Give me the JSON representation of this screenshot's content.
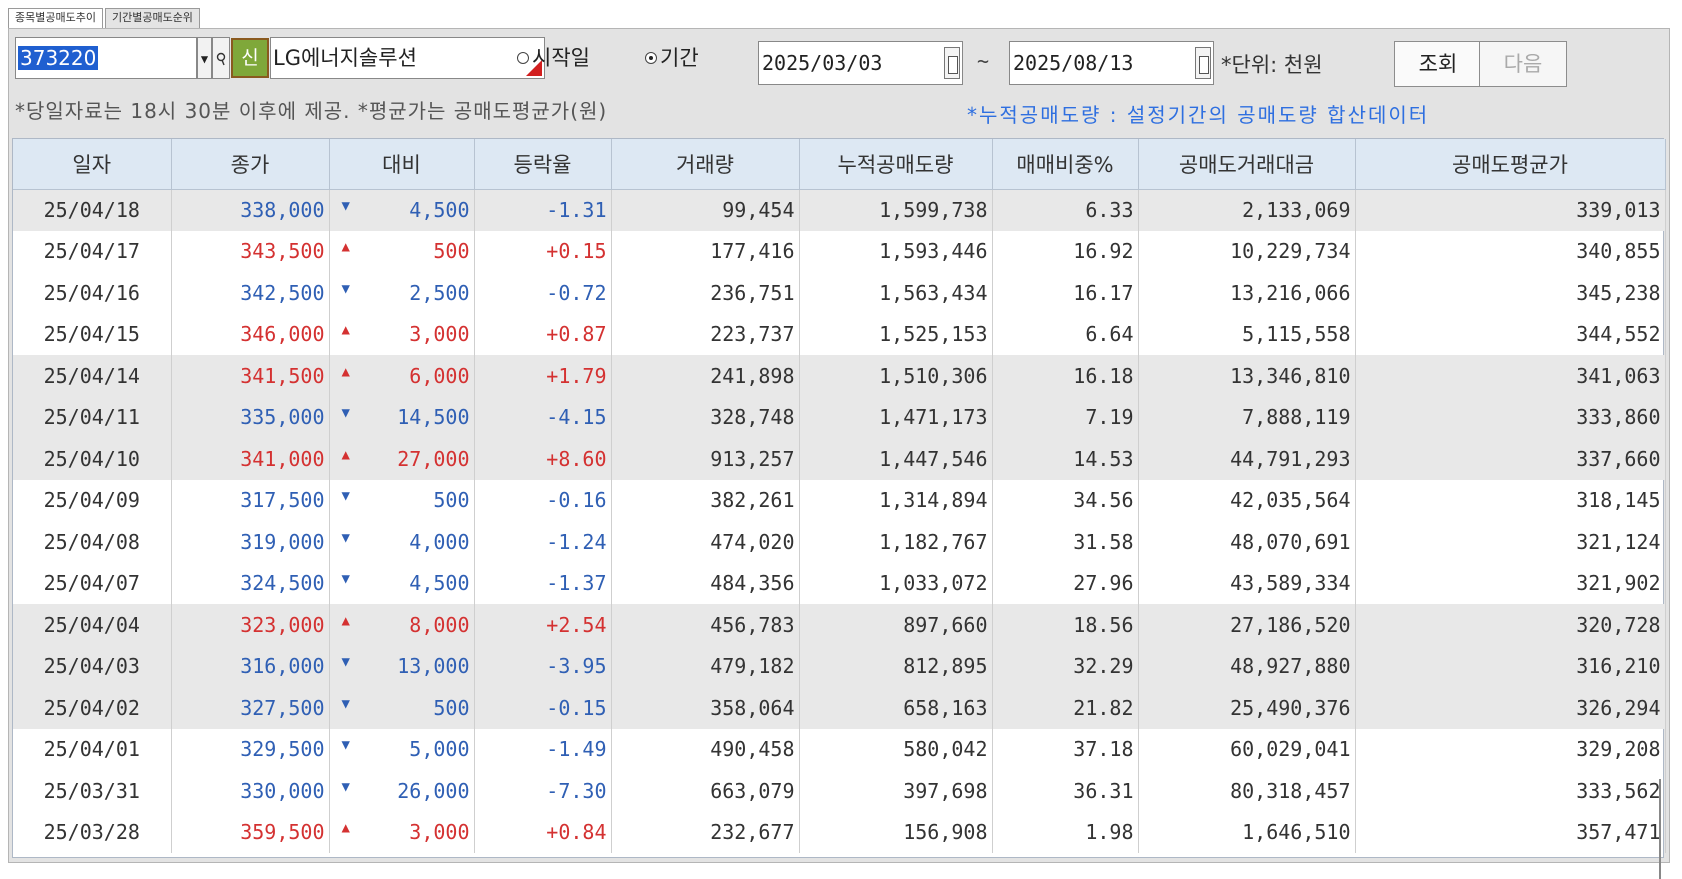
{
  "tabs": [
    {
      "label": "종목별공매도추이",
      "active": true
    },
    {
      "label": "기간별공매도순위",
      "active": false
    }
  ],
  "toolbar": {
    "code": "373220",
    "new_badge": "신",
    "stock_name": "LG에너지솔루션",
    "radio_start": "시작일",
    "radio_period": "기간",
    "selected_radio": "period",
    "start_date": "2025/03/03",
    "tilde": "~",
    "end_date": "2025/08/13",
    "unit": "*단위: 천원",
    "query_button": "조회",
    "next_button": "다음"
  },
  "notes": {
    "left": "*당일자료는 18시 30분 이후에 제공. *평균가는 공매도평균가(원)",
    "right": "*누적공매도량 : 설정기간의 공매도량 합산데이터"
  },
  "colors": {
    "up": "#d43131",
    "down": "#2f5fb4",
    "header": "#dde8f3",
    "highlight_row": "#e8e8e8"
  },
  "table": {
    "headers": [
      "일자",
      "종가",
      "대비",
      "등락율",
      "거래량",
      "누적공매도량",
      "매매비중%",
      "공매도거래대금",
      "공매도평균가"
    ],
    "rows": [
      {
        "date": "25/04/18",
        "close": "338,000",
        "dir": "down",
        "arrow": "▼",
        "change": "4,500",
        "rate": "-1.31",
        "volume": "99,454",
        "cum_short": "1,599,738",
        "ratio": "6.33",
        "short_amount": "2,133,069",
        "short_avg": "339,013",
        "shaded": true
      },
      {
        "date": "25/04/17",
        "close": "343,500",
        "dir": "up",
        "arrow": "▲",
        "change": "500",
        "rate": "+0.15",
        "volume": "177,416",
        "cum_short": "1,593,446",
        "ratio": "16.92",
        "short_amount": "10,229,734",
        "short_avg": "340,855",
        "shaded": false
      },
      {
        "date": "25/04/16",
        "close": "342,500",
        "dir": "down",
        "arrow": "▼",
        "change": "2,500",
        "rate": "-0.72",
        "volume": "236,751",
        "cum_short": "1,563,434",
        "ratio": "16.17",
        "short_amount": "13,216,066",
        "short_avg": "345,238",
        "shaded": false
      },
      {
        "date": "25/04/15",
        "close": "346,000",
        "dir": "up",
        "arrow": "▲",
        "change": "3,000",
        "rate": "+0.87",
        "volume": "223,737",
        "cum_short": "1,525,153",
        "ratio": "6.64",
        "short_amount": "5,115,558",
        "short_avg": "344,552",
        "shaded": false
      },
      {
        "date": "25/04/14",
        "close": "341,500",
        "dir": "up",
        "arrow": "▲",
        "change": "6,000",
        "rate": "+1.79",
        "volume": "241,898",
        "cum_short": "1,510,306",
        "ratio": "16.18",
        "short_amount": "13,346,810",
        "short_avg": "341,063",
        "shaded": true
      },
      {
        "date": "25/04/11",
        "close": "335,000",
        "dir": "down",
        "arrow": "▼",
        "change": "14,500",
        "rate": "-4.15",
        "volume": "328,748",
        "cum_short": "1,471,173",
        "ratio": "7.19",
        "short_amount": "7,888,119",
        "short_avg": "333,860",
        "shaded": true
      },
      {
        "date": "25/04/10",
        "close": "341,000",
        "dir": "up",
        "arrow": "▲",
        "change": "27,000",
        "rate": "+8.60",
        "volume": "913,257",
        "cum_short": "1,447,546",
        "ratio": "14.53",
        "short_amount": "44,791,293",
        "short_avg": "337,660",
        "shaded": true
      },
      {
        "date": "25/04/09",
        "close": "317,500",
        "dir": "down",
        "arrow": "▼",
        "change": "500",
        "rate": "-0.16",
        "volume": "382,261",
        "cum_short": "1,314,894",
        "ratio": "34.56",
        "short_amount": "42,035,564",
        "short_avg": "318,145",
        "shaded": false
      },
      {
        "date": "25/04/08",
        "close": "319,000",
        "dir": "down",
        "arrow": "▼",
        "change": "4,000",
        "rate": "-1.24",
        "volume": "474,020",
        "cum_short": "1,182,767",
        "ratio": "31.58",
        "short_amount": "48,070,691",
        "short_avg": "321,124",
        "shaded": false
      },
      {
        "date": "25/04/07",
        "close": "324,500",
        "dir": "down",
        "arrow": "▼",
        "change": "4,500",
        "rate": "-1.37",
        "volume": "484,356",
        "cum_short": "1,033,072",
        "ratio": "27.96",
        "short_amount": "43,589,334",
        "short_avg": "321,902",
        "shaded": false
      },
      {
        "date": "25/04/04",
        "close": "323,000",
        "dir": "up",
        "arrow": "▲",
        "change": "8,000",
        "rate": "+2.54",
        "volume": "456,783",
        "cum_short": "897,660",
        "ratio": "18.56",
        "short_amount": "27,186,520",
        "short_avg": "320,728",
        "shaded": true
      },
      {
        "date": "25/04/03",
        "close": "316,000",
        "dir": "down",
        "arrow": "▼",
        "change": "13,000",
        "rate": "-3.95",
        "volume": "479,182",
        "cum_short": "812,895",
        "ratio": "32.29",
        "short_amount": "48,927,880",
        "short_avg": "316,210",
        "shaded": true
      },
      {
        "date": "25/04/02",
        "close": "327,500",
        "dir": "down",
        "arrow": "▼",
        "change": "500",
        "rate": "-0.15",
        "volume": "358,064",
        "cum_short": "658,163",
        "ratio": "21.82",
        "short_amount": "25,490,376",
        "short_avg": "326,294",
        "shaded": true
      },
      {
        "date": "25/04/01",
        "close": "329,500",
        "dir": "down",
        "arrow": "▼",
        "change": "5,000",
        "rate": "-1.49",
        "volume": "490,458",
        "cum_short": "580,042",
        "ratio": "37.18",
        "short_amount": "60,029,041",
        "short_avg": "329,208",
        "shaded": false
      },
      {
        "date": "25/03/31",
        "close": "330,000",
        "dir": "down",
        "arrow": "▼",
        "change": "26,000",
        "rate": "-7.30",
        "volume": "663,079",
        "cum_short": "397,698",
        "ratio": "36.31",
        "short_amount": "80,318,457",
        "short_avg": "333,562",
        "shaded": false
      },
      {
        "date": "25/03/28",
        "close": "359,500",
        "dir": "up",
        "arrow": "▲",
        "change": "3,000",
        "rate": "+0.84",
        "volume": "232,677",
        "cum_short": "156,908",
        "ratio": "1.98",
        "short_amount": "1,646,510",
        "short_avg": "357,471",
        "shaded": false
      }
    ]
  }
}
